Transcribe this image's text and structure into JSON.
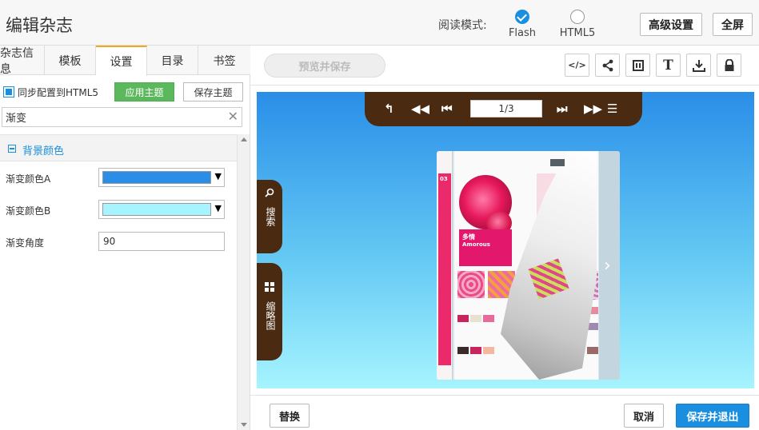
{
  "header": {
    "title": "编辑杂志",
    "mode_label": "阅读模式:",
    "modes": [
      {
        "label": "Flash",
        "selected": true
      },
      {
        "label": "HTML5",
        "selected": false
      }
    ],
    "advanced_label": "高级设置",
    "fullscreen_label": "全屏"
  },
  "tabs": [
    {
      "label": "杂志信息",
      "active": false
    },
    {
      "label": "模板",
      "active": false
    },
    {
      "label": "设置",
      "active": true
    },
    {
      "label": "目录",
      "active": false
    },
    {
      "label": "书签",
      "active": false
    }
  ],
  "sync": {
    "label": "同步配置到HTML5",
    "checked": true,
    "apply_label": "应用主题",
    "save_label": "保存主题"
  },
  "search": {
    "value": "渐变"
  },
  "section": {
    "title": "背景颜色",
    "fields": [
      {
        "label": "渐变颜色A",
        "type": "color",
        "value": "#2a8ee8"
      },
      {
        "label": "渐变颜色B",
        "type": "color",
        "value": "#a6f4ff"
      },
      {
        "label": "渐变角度",
        "type": "number",
        "value": "90"
      }
    ]
  },
  "toolbar": {
    "preview_label": "预览并保存",
    "tools": [
      {
        "name": "code-icon",
        "glyph": "</>"
      },
      {
        "name": "share-icon",
        "glyph": "<"
      },
      {
        "name": "layout-icon",
        "glyph": "▥"
      },
      {
        "name": "text-icon",
        "glyph": "T"
      },
      {
        "name": "download-icon",
        "glyph": "⤓"
      },
      {
        "name": "lock-icon",
        "glyph": "🔒"
      }
    ]
  },
  "viewer": {
    "page_indicator": "1/3",
    "side_tabs": [
      {
        "label": "搜索",
        "icon": "search-icon"
      },
      {
        "label": "缩略图",
        "icon": "grid-icon"
      }
    ],
    "page": {
      "number": "03",
      "title": "多情",
      "subtitle": "Amorous"
    }
  },
  "footer": {
    "replace_label": "替换",
    "cancel_label": "取消",
    "save_exit_label": "保存并退出"
  }
}
